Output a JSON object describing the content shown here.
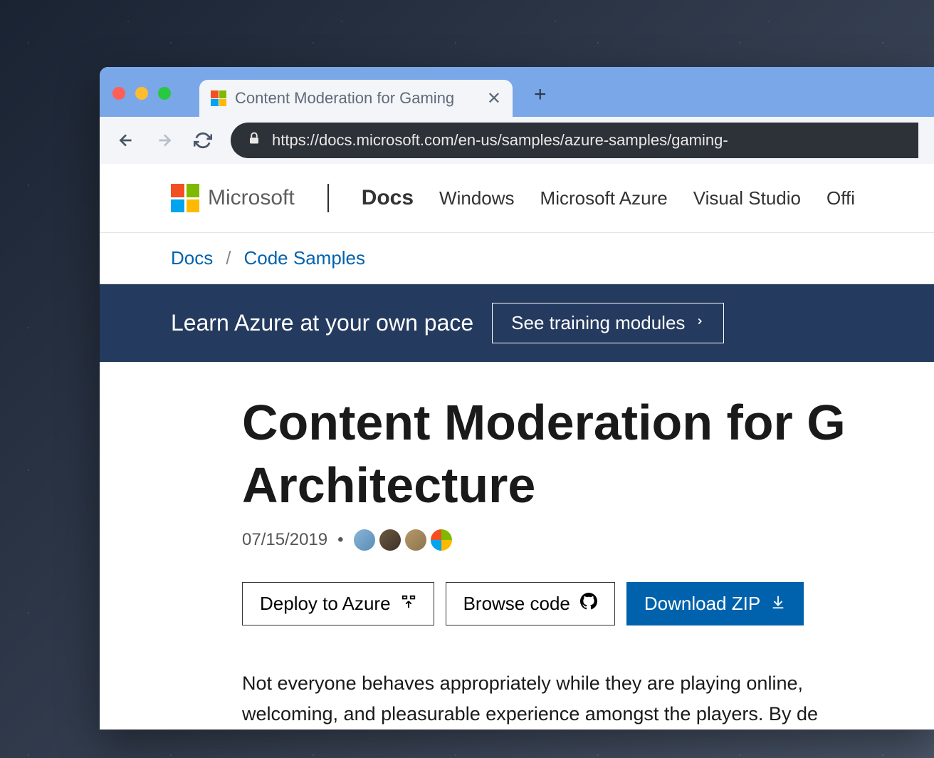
{
  "browser": {
    "tab_title": "Content Moderation for Gaming",
    "url": "https://docs.microsoft.com/en-us/samples/azure-samples/gaming-"
  },
  "header": {
    "brand": "Microsoft",
    "nav": [
      "Docs",
      "Windows",
      "Microsoft Azure",
      "Visual Studio",
      "Offi"
    ]
  },
  "breadcrumb": {
    "items": [
      "Docs",
      "Code Samples"
    ]
  },
  "banner": {
    "text": "Learn Azure at your own pace",
    "button": "See training modules"
  },
  "article": {
    "title_line1": "Content Moderation for G",
    "title_line2": "Architecture",
    "date": "07/15/2019",
    "buttons": {
      "deploy": "Deploy to Azure",
      "browse": "Browse code",
      "download": "Download ZIP"
    },
    "body_line1": "Not everyone behaves appropriately while they are playing online, ",
    "body_line2": "welcoming, and pleasurable experience amongst the players. By de"
  }
}
